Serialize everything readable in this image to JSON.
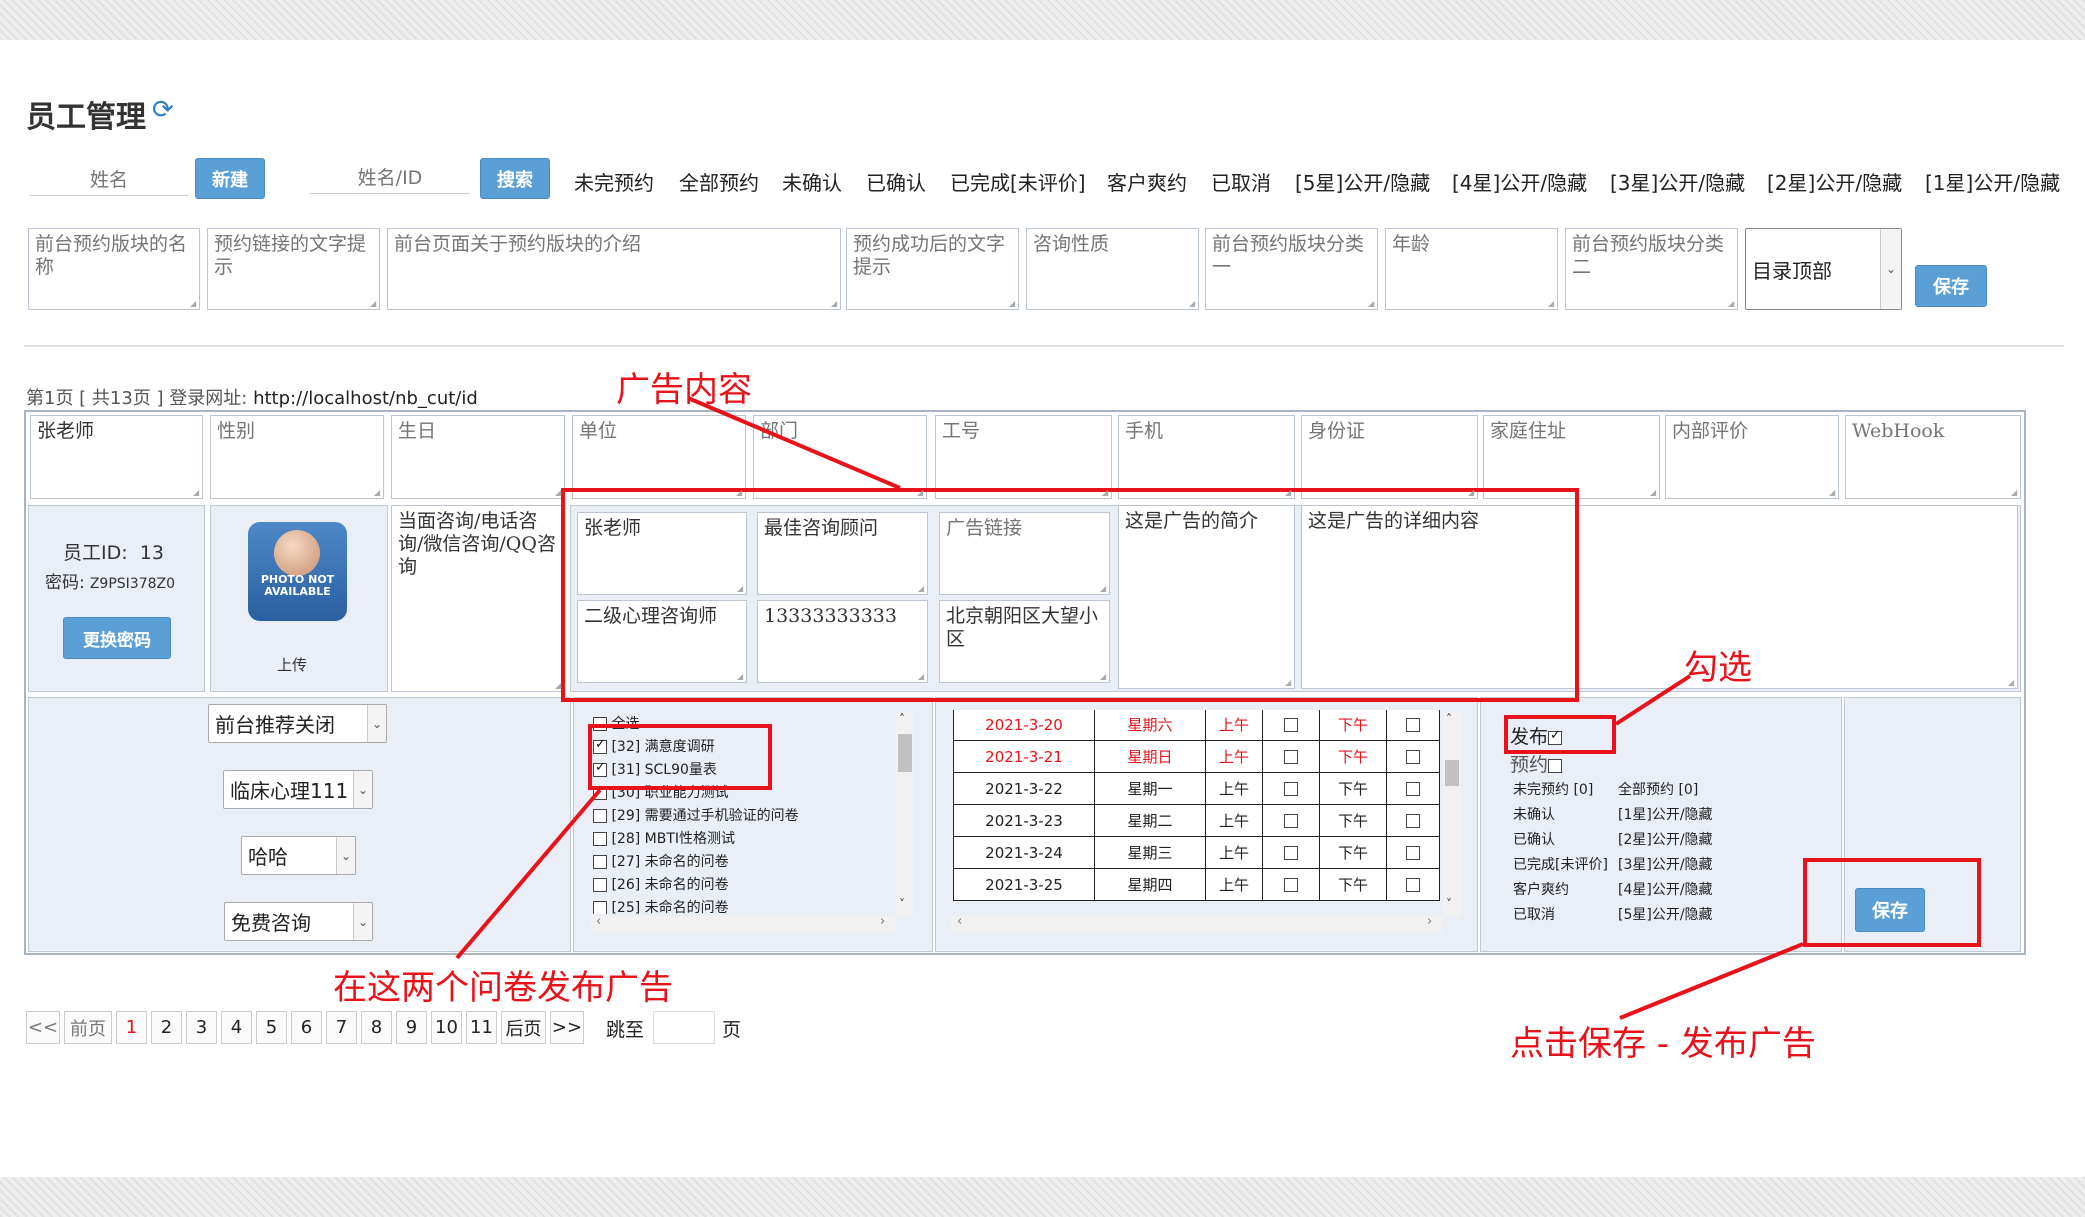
{
  "page_title": "员工管理",
  "toolbar": {
    "name_placeholder": "姓名",
    "new_button": "新建",
    "search_placeholder": "姓名/ID",
    "search_button": "搜索",
    "filters": [
      "未完预约",
      "全部预约",
      "未确认",
      "已确认",
      "已完成[未评价]",
      "客户爽约",
      "已取消",
      "[5星]公开/隐藏",
      "[4星]公开/隐藏",
      "[3星]公开/隐藏",
      "[2星]公开/隐藏",
      "[1星]公开/隐藏"
    ]
  },
  "booking_config": {
    "fields": [
      "前台预约版块的名称",
      "预约链接的文字提示",
      "前台页面关于预约版块的介绍",
      "预约成功后的文字提示",
      "咨询性质",
      "前台预约版块分类一",
      "年龄",
      "前台预约版块分类二"
    ],
    "directory_select": "目录顶部",
    "save_button": "保存"
  },
  "list_info": {
    "page_label": "第1页 [ 共13页 ] 登录网址:",
    "login_url": "http://localhost/nb_cut/id"
  },
  "employee_fields": {
    "name": "张老师",
    "placeholders": [
      "性别",
      "生日",
      "单位",
      "部门",
      "工号",
      "手机",
      "身份证",
      "家庭住址",
      "内部评价",
      "WebHook"
    ]
  },
  "employee_card": {
    "id_label": "员工ID:",
    "id_value": "13",
    "pwd_label": "密码:",
    "pwd_value": "Z9PSI378Z0",
    "change_pwd_button": "更换密码",
    "photo_text": "PHOTO NOT AVAILABLE",
    "upload_label": "上传",
    "consult_methods": "当面咨询/电话咨询/微信咨询/QQ咨询"
  },
  "ad": {
    "name": "张老师",
    "title": "最佳咨询顾问",
    "link_placeholder": "广告链接",
    "level": "二级心理咨询师",
    "phone": "13333333333",
    "address": "北京朝阳区大望小区",
    "intro": "这是广告的简介",
    "detail": "这是广告的详细内容"
  },
  "settings": {
    "recommend": "前台推荐关闭",
    "category": "临床心理111",
    "sub": "哈哈",
    "consult_type": "免费咨询"
  },
  "questionnaires": {
    "select_all": "全选",
    "items": [
      {
        "label": "[32] 满意度调研",
        "checked": true
      },
      {
        "label": "[31] SCL90量表",
        "checked": true
      },
      {
        "label": "[30] 职业能力测试",
        "checked": false
      },
      {
        "label": "[29] 需要通过手机验证的问卷",
        "checked": false
      },
      {
        "label": "[28] MBTI性格测试",
        "checked": false
      },
      {
        "label": "[27] 未命名的问卷",
        "checked": false
      },
      {
        "label": "[26] 未命名的问卷",
        "checked": false
      },
      {
        "label": "[25] 未命名的问卷",
        "checked": false
      }
    ]
  },
  "schedule": {
    "am": "上午",
    "pm": "下午",
    "rows": [
      {
        "date": "2021-3-20",
        "weekday": "星期六",
        "weekend": true
      },
      {
        "date": "2021-3-21",
        "weekday": "星期日",
        "weekend": true
      },
      {
        "date": "2021-3-22",
        "weekday": "星期一",
        "weekend": false
      },
      {
        "date": "2021-3-23",
        "weekday": "星期二",
        "weekend": false
      },
      {
        "date": "2021-3-24",
        "weekday": "星期三",
        "weekend": false
      },
      {
        "date": "2021-3-25",
        "weekday": "星期四",
        "weekend": false
      }
    ]
  },
  "publish": {
    "publish_label": "发布",
    "publish_checked": true,
    "booking_label": "预约",
    "booking_checked": false,
    "stats": [
      [
        "未完预约 [0]",
        "全部预约 [0]"
      ],
      [
        "未确认",
        "[1星]公开/隐藏"
      ],
      [
        "已确认",
        "[2星]公开/隐藏"
      ],
      [
        "已完成[未评价]",
        "[3星]公开/隐藏"
      ],
      [
        "客户爽约",
        "[4星]公开/隐藏"
      ],
      [
        "已取消",
        "[5星]公开/隐藏"
      ]
    ],
    "save_button": "保存"
  },
  "pagination": {
    "first": "<<",
    "prev": "前页",
    "pages": [
      "1",
      "2",
      "3",
      "4",
      "5",
      "6",
      "7",
      "8",
      "9",
      "10",
      "11"
    ],
    "next": "后页",
    "last": ">>",
    "jump_label": "跳至",
    "jump_suffix": "页"
  },
  "annotations": {
    "ad_content": "广告内容",
    "tick": "勾选",
    "questionnaire_note": "在这两个问卷发布广告",
    "save_note": "点击保存 - 发布广告"
  },
  "colors": {
    "accent_blue": "#5a9fd6",
    "annotation_red": "#e8121a",
    "panel_bg": "#e9eef7"
  }
}
